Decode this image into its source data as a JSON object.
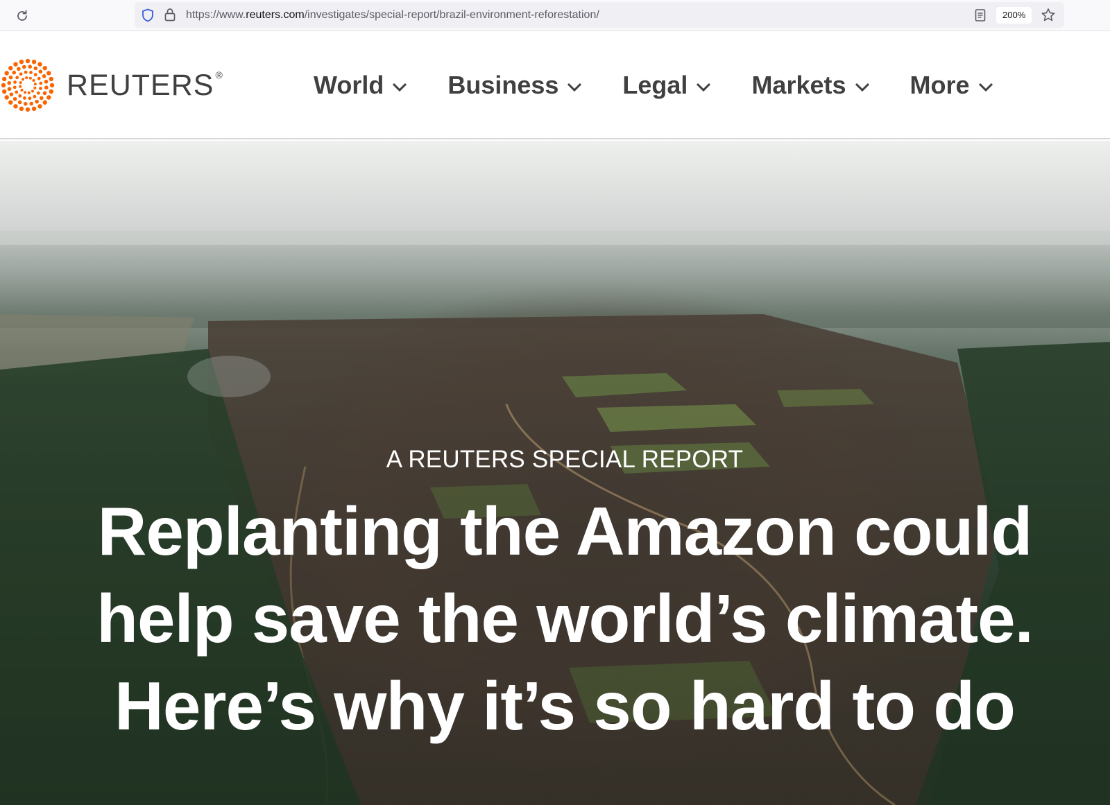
{
  "browser": {
    "url_prefix": "https://www.",
    "url_domain": "reuters.com",
    "url_path": "/investigates/special-report/brazil-environment-reforestation/",
    "zoom": "200%",
    "icons": [
      "reload-icon",
      "shield-icon",
      "lock-icon",
      "reader-view-icon",
      "bookmark-star-icon"
    ]
  },
  "header": {
    "logo_text": "REUTERS",
    "logo_registered": "®",
    "brand_color": "#fa6400",
    "nav": [
      {
        "label": "World"
      },
      {
        "label": "Business"
      },
      {
        "label": "Legal"
      },
      {
        "label": "Markets"
      },
      {
        "label": "More"
      }
    ]
  },
  "hero": {
    "kicker": "A REUTERS SPECIAL REPORT",
    "headline_lines": [
      "Replanting the Amazon could",
      "help save the world’s climate.",
      "Here’s why it’s so hard to do"
    ]
  }
}
